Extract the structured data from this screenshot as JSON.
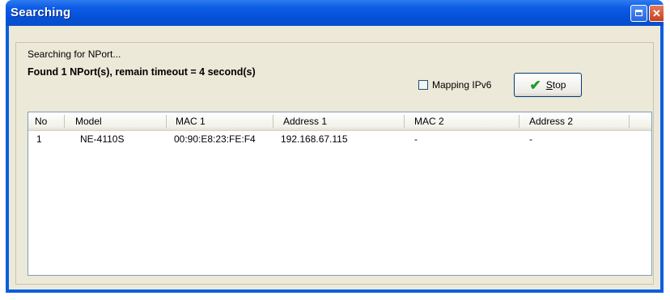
{
  "window": {
    "title": "Searching"
  },
  "status": {
    "searching_label": "Searching for NPort...",
    "found_label": "Found 1 NPort(s), remain timeout = 4 second(s)"
  },
  "mapping_ipv6": {
    "label": "Mapping IPv6",
    "checked": false
  },
  "stop_button": {
    "mnemonic": "S",
    "rest": "top",
    "icon": "checkmark-icon"
  },
  "table": {
    "columns": [
      "No",
      "Model",
      "MAC 1",
      "Address 1",
      "MAC 2",
      "Address 2"
    ],
    "rows": [
      [
        "1",
        "NE-4110S",
        "00:90:E8:23:FE:F4",
        "192.168.67.115",
        "-",
        "-"
      ]
    ]
  },
  "colors": {
    "titlebar": "#0a5ee0",
    "client_bg": "#ece9d8",
    "check_green": "#1f9a2c"
  }
}
